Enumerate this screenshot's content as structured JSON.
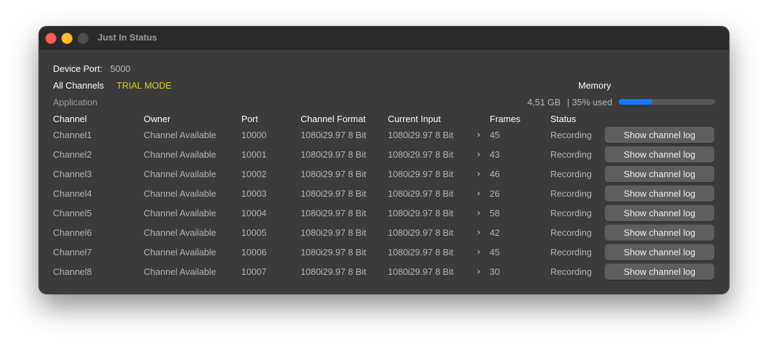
{
  "window": {
    "title": "Just In Status"
  },
  "device": {
    "port_label": "Device Port:",
    "port_value": "5000"
  },
  "channels_label": "All Channels",
  "trial_mode": "TRIAL MODE",
  "application_label": "Application",
  "memory": {
    "label": "Memory",
    "usage": "4,51 GB",
    "percent_text": "| 35% used",
    "percent_value": 0.35
  },
  "colors": {
    "accent": "#1279ff",
    "trial": "#d9d12a",
    "input_ok": "#3fcf1c",
    "recording": "#cc2a23"
  },
  "table": {
    "headers": {
      "channel": "Channel",
      "owner": "Owner",
      "port": "Port",
      "format": "Channel Format",
      "input": "Current Input",
      "frames": "Frames",
      "status": "Status"
    },
    "button_label": "Show channel log",
    "chevron_icon": "chevron-right-icon",
    "rows": [
      {
        "channel": "Channel1",
        "owner": "Channel Available",
        "port": "10000",
        "format": "1080i29.97 8 Bit",
        "input": "1080i29.97 8 Bit",
        "frames": "45",
        "status": "Recording"
      },
      {
        "channel": "Channel2",
        "owner": "Channel Available",
        "port": "10001",
        "format": "1080i29.97 8 Bit",
        "input": "1080i29.97 8 Bit",
        "frames": "43",
        "status": "Recording"
      },
      {
        "channel": "Channel3",
        "owner": "Channel Available",
        "port": "10002",
        "format": "1080i29.97 8 Bit",
        "input": "1080i29.97 8 Bit",
        "frames": "46",
        "status": "Recording"
      },
      {
        "channel": "Channel4",
        "owner": "Channel Available",
        "port": "10003",
        "format": "1080i29.97 8 Bit",
        "input": "1080i29.97 8 Bit",
        "frames": "26",
        "status": "Recording"
      },
      {
        "channel": "Channel5",
        "owner": "Channel Available",
        "port": "10004",
        "format": "1080i29.97 8 Bit",
        "input": "1080i29.97 8 Bit",
        "frames": "58",
        "status": "Recording"
      },
      {
        "channel": "Channel6",
        "owner": "Channel Available",
        "port": "10005",
        "format": "1080i29.97 8 Bit",
        "input": "1080i29.97 8 Bit",
        "frames": "42",
        "status": "Recording"
      },
      {
        "channel": "Channel7",
        "owner": "Channel Available",
        "port": "10006",
        "format": "1080i29.97 8 Bit",
        "input": "1080i29.97 8 Bit",
        "frames": "45",
        "status": "Recording"
      },
      {
        "channel": "Channel8",
        "owner": "Channel Available",
        "port": "10007",
        "format": "1080i29.97 8 Bit",
        "input": "1080i29.97 8 Bit",
        "frames": "30",
        "status": "Recording"
      }
    ]
  }
}
